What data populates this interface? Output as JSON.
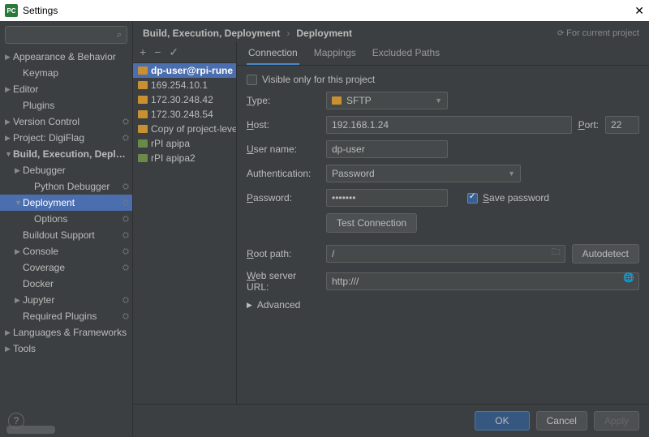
{
  "window": {
    "title": "Settings"
  },
  "search": {
    "placeholder": ""
  },
  "nav": {
    "appearance": "Appearance & Behavior",
    "keymap": "Keymap",
    "editor": "Editor",
    "plugins": "Plugins",
    "vcs": "Version Control",
    "project": "Project: DigiFlag",
    "build": "Build, Execution, Deployment",
    "debugger": "Debugger",
    "pydebugger": "Python Debugger",
    "deployment": "Deployment",
    "options": "Options",
    "buildout": "Buildout Support",
    "console": "Console",
    "coverage": "Coverage",
    "docker": "Docker",
    "jupyter": "Jupyter",
    "reqplugins": "Required Plugins",
    "langs": "Languages & Frameworks",
    "tools": "Tools"
  },
  "breadcrumb": {
    "a": "Build, Execution, Deployment",
    "b": "Deployment",
    "proj": "For current project"
  },
  "toolbar": {
    "add": "+",
    "remove": "−",
    "check": "✓"
  },
  "servers": [
    {
      "name": "dp-user@rpi-rune"
    },
    {
      "name": "169.254.10.1"
    },
    {
      "name": "172.30.248.42"
    },
    {
      "name": "172.30.248.54"
    },
    {
      "name": "Copy of project-level serv"
    },
    {
      "name": "rPI apipa"
    },
    {
      "name": "rPI apipa2"
    }
  ],
  "tabs": {
    "connection": "Connection",
    "mappings": "Mappings",
    "excluded": "Excluded Paths"
  },
  "form": {
    "visible_only": "Visible only for this project",
    "type_label": "Type:",
    "type_value": "SFTP",
    "host_label": "Host:",
    "host_value": "192.168.1.24",
    "port_label": "Port:",
    "port_value": "22",
    "user_label": "User name:",
    "user_value": "dp-user",
    "auth_label": "Authentication:",
    "auth_value": "Password",
    "pass_label": "Password:",
    "pass_value": "•••••••",
    "save_pass": "Save password",
    "test_conn": "Test Connection",
    "root_label": "Root path:",
    "root_value": "/",
    "autodetect": "Autodetect",
    "web_label": "Web server URL:",
    "web_value": "http:///",
    "advanced": "Advanced"
  },
  "footer": {
    "ok": "OK",
    "cancel": "Cancel",
    "apply": "Apply"
  }
}
